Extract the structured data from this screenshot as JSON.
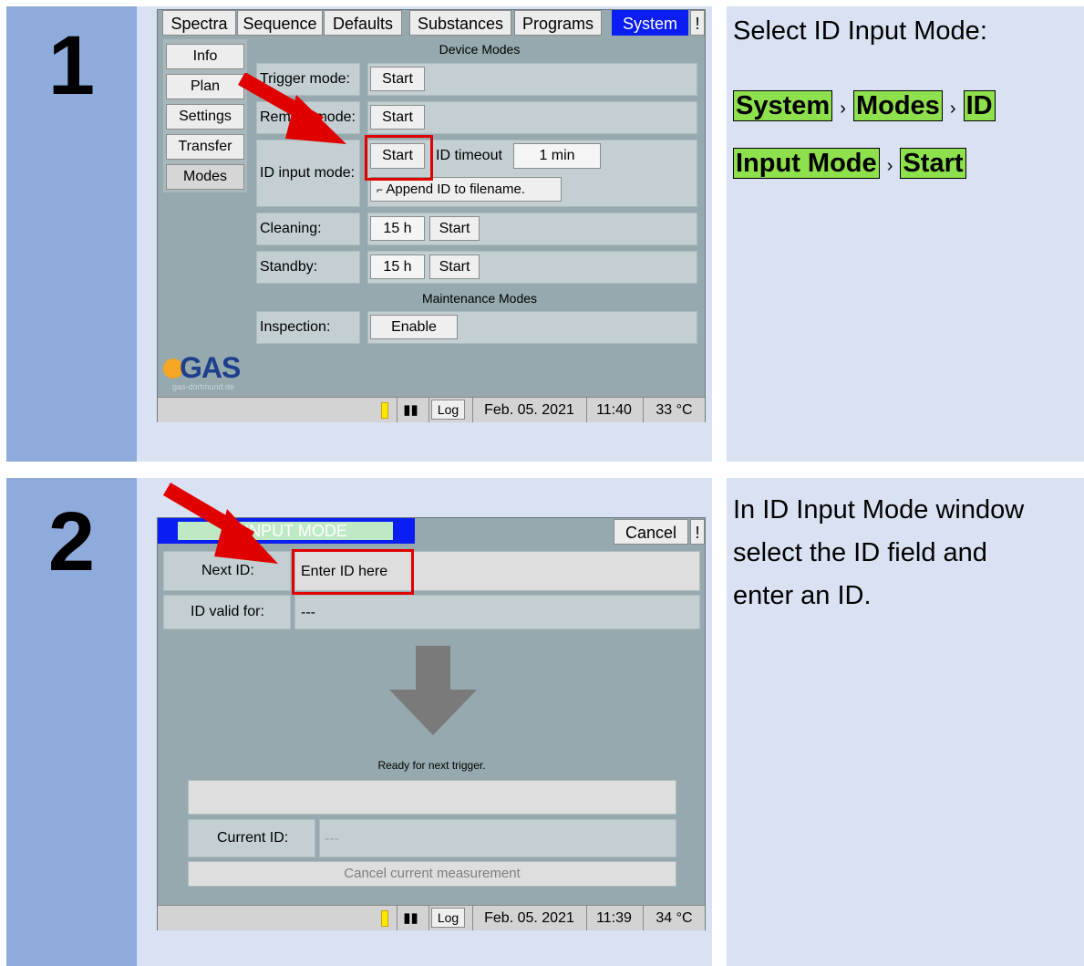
{
  "steps": [
    {
      "number": "1",
      "instruction": "Select ID Input Mode:"
    },
    {
      "number": "2",
      "instruction_lines": [
        "In ID Input Mode window",
        "select the ID field and",
        "enter an ID."
      ]
    }
  ],
  "breadcrumb": {
    "items": [
      "System",
      "Modes",
      "ID",
      "Input Mode",
      "Start"
    ],
    "separator": "›"
  },
  "screen1": {
    "tabs": [
      "Spectra",
      "Sequence",
      "Defaults",
      "Substances",
      "Programs",
      "System",
      "!"
    ],
    "active_tab": "System",
    "side_menu": [
      "Info",
      "Plan",
      "Settings",
      "Transfer",
      "Modes"
    ],
    "section_device": "Device Modes",
    "section_maintenance": "Maintenance Modes",
    "trigger_label": "Trigger mode:",
    "remote_label": "Remote mode:",
    "id_input_label": "ID input mode:",
    "cleaning_label": "Cleaning:",
    "standby_label": "Standby:",
    "inspection_label": "Inspection:",
    "start_label": "Start",
    "id_timeout_label": "ID timeout",
    "id_timeout_value": "1 min",
    "append_label": "Append ID to filename.",
    "cleaning_value": "15 h",
    "standby_value": "15 h",
    "enable_label": "Enable",
    "logo_text": "GAS",
    "logo_sub": "gas-dortmund.de",
    "status": {
      "log": "Log",
      "date": "Feb. 05. 2021",
      "time": "11:40",
      "temp": "33 °C"
    }
  },
  "screen2": {
    "title": "ID INPUT MODE",
    "cancel_label": "Cancel",
    "bang_label": "!",
    "next_id_label": "Next ID:",
    "next_id_placeholder": "Enter ID here",
    "valid_label": "ID valid for:",
    "valid_value": "---",
    "ready_text": "Ready for next trigger.",
    "current_id_label": "Current ID:",
    "current_id_value": "---",
    "cancel_measurement": "Cancel current measurement",
    "status": {
      "log": "Log",
      "date": "Feb. 05. 2021",
      "time": "11:39",
      "temp": "34 °C"
    }
  },
  "colors": {
    "active_tab": "#0a1df2",
    "highlight": "#8ee04c",
    "callout": "#e00000",
    "logo_orange": "#f5a623"
  }
}
